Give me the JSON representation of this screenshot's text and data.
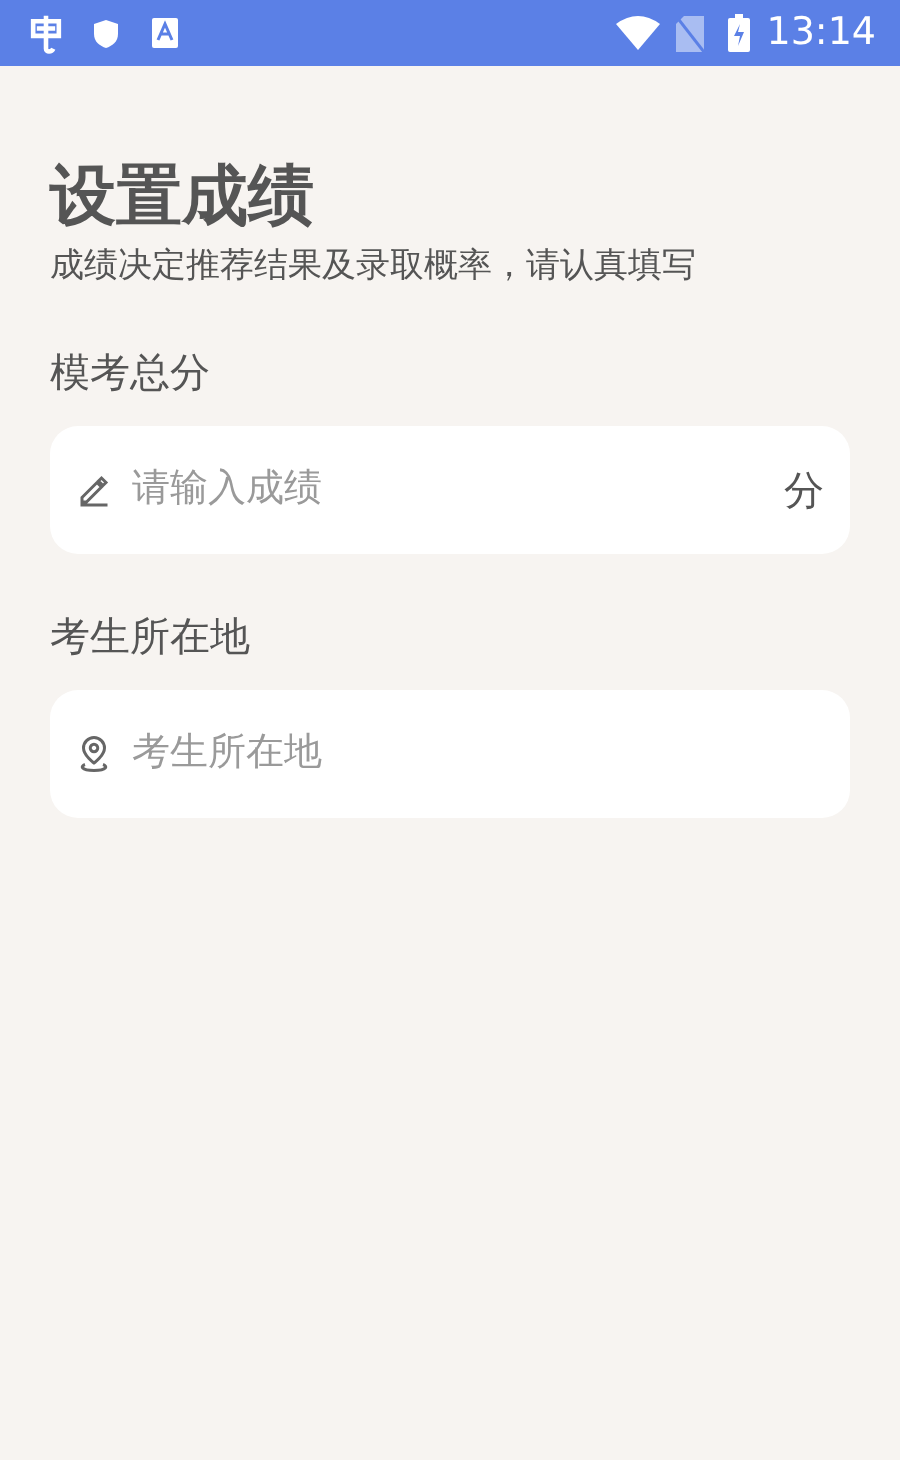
{
  "status_bar": {
    "time": "13:14"
  },
  "title": "设置成绩",
  "subtitle": "成绩决定推荐结果及录取概率，请认真填写",
  "fields": [
    {
      "kind": "score",
      "label": "模考总分",
      "placeholder": "请输入成绩",
      "suffix": "分"
    },
    {
      "kind": "location",
      "label": "考生所在地",
      "placeholder": "考生所在地"
    }
  ]
}
